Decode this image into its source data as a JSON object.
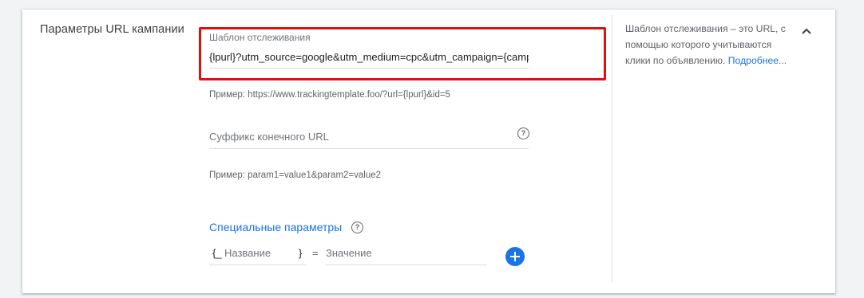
{
  "section": {
    "title": "Параметры URL кампании"
  },
  "tracking_template": {
    "label": "Шаблон отслеживания",
    "value": "{lpurl}?utm_source=google&utm_medium=cpc&utm_campaign={campaignid}",
    "example": "Пример: https://www.trackingtemplate.foo/?url={lpurl}&id=5"
  },
  "final_url_suffix": {
    "placeholder": "Суффикс конечного URL",
    "help_icon": "help-circle-icon",
    "example": "Пример: param1=value1&param2=value2"
  },
  "custom_params": {
    "heading": "Специальные параметры",
    "help_icon": "help-circle-icon",
    "open_brace": "{_",
    "name_placeholder": "Название",
    "close_brace": "}",
    "equals": "=",
    "value_placeholder": "Значение",
    "add_icon": "plus-icon"
  },
  "side_help": {
    "text": "Шаблон отслеживания – это URL, с помощью которого учитываются клики по объявлению.",
    "link": "Подробнее..."
  },
  "collapse_icon": "chevron-up-icon",
  "colors": {
    "accent": "#1a73e8",
    "highlight": "#e01010"
  }
}
